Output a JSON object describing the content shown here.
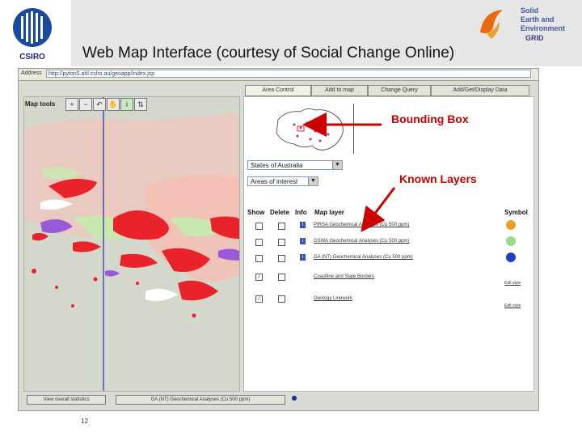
{
  "slide": {
    "title": "Web Map Interface (courtesy of Social Change Online)",
    "page_number": "12"
  },
  "logos": {
    "left": "CSIRO",
    "right_lines": [
      "Solid",
      "Earth and",
      "Environment",
      "GRID"
    ]
  },
  "browser": {
    "address_label": "Address",
    "url": "http://pyton5.ahl.cslro.au/geoapp/index.jsp"
  },
  "tabs": [
    {
      "label": "Area Control"
    },
    {
      "label": "Add to map"
    },
    {
      "label": "Change Query"
    },
    {
      "label": "Add/Get/Display Data"
    }
  ],
  "map": {
    "tools_label": "Map tools",
    "tools": [
      "zoom-in-icon",
      "zoom-out-icon",
      "undo-icon",
      "pan-hand-icon",
      "info-icon",
      "refresh-icon"
    ]
  },
  "panel": {
    "state_select": "States of Australia",
    "area_select": "Areas of interest",
    "headers": {
      "show": "Show",
      "delete": "Delete",
      "info": "Info",
      "layer": "Map layer",
      "symbol": "Symbol"
    },
    "layers": [
      {
        "name": "PIRSA Geochemical Analyses (Cu 500 ppm)",
        "show": false,
        "info": true,
        "symbol_color": "#f0a020"
      },
      {
        "name": "GSWA Geochemical Analyses (Cu 500 ppm)",
        "show": false,
        "info": true,
        "symbol_color": "#9ad88a"
      },
      {
        "name": "GA (NT) Geochemical Analyses (Cu 500 ppm)",
        "show": false,
        "info": true,
        "symbol_color": "#2040c0"
      },
      {
        "name": "Coastline and State Borders",
        "show": true,
        "info": false
      },
      {
        "name": "Geology Linework",
        "show": true,
        "info": false
      }
    ],
    "symbol_mini_1": "Edit style",
    "symbol_mini_2": "Edit style"
  },
  "bottom": {
    "btn1": "View overall statistics",
    "btn2": "GA (NT) Geochemical Analyses (Cu 500 ppm)"
  },
  "annotations": {
    "bbox_label": "Bounding Box",
    "layers_label": "Known Layers"
  },
  "colors": {
    "annotation": "#cc0000",
    "geology_red": "#e8242a",
    "geology_pink": "#f4c0b8",
    "geology_purple": "#9a5ad8",
    "geology_green": "#c8e8b0"
  }
}
